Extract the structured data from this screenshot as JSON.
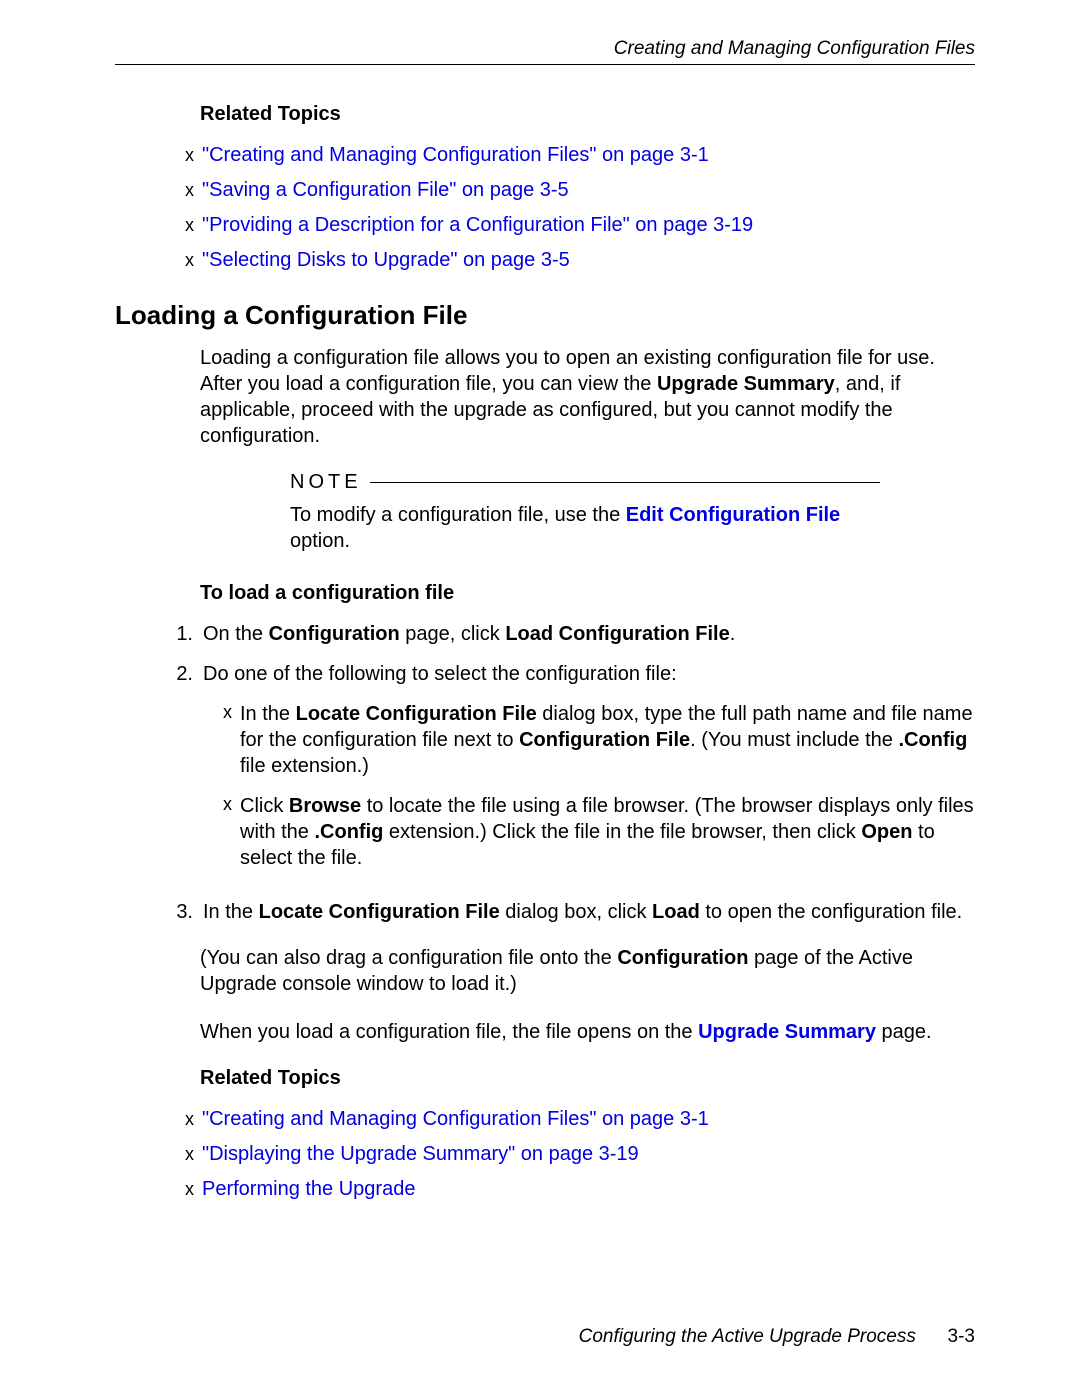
{
  "header": {
    "title": "Creating and Managing Configuration Files"
  },
  "relatedTopics1": {
    "heading": "Related Topics",
    "links": [
      "\"Creating and Managing Configuration Files\" on page 3-1",
      "\"Saving a Configuration File\" on page 3-5",
      "\"Providing a Description for a Configuration File\" on page 3-19",
      "\"Selecting Disks to Upgrade\" on page 3-5"
    ]
  },
  "section": {
    "heading": "Loading a Configuration File",
    "intro_part1": "Loading a configuration file allows you to open an existing configuration file for use. After you load a configuration file, you can view the ",
    "intro_bold1": "Upgrade Summary",
    "intro_part2": ", and, if applicable, proceed with the upgrade as configured, but you cannot modify the configuration."
  },
  "note": {
    "label": "NOTE",
    "text_part1": "To modify a configuration file, use the ",
    "link_text": "Edit Configuration File",
    "text_part2": " option."
  },
  "procedure": {
    "heading": "To load a configuration file",
    "step1_p1": "On the ",
    "step1_b1": "Configuration",
    "step1_p2": " page, click ",
    "step1_b2": "Load Configuration File",
    "step1_p3": ".",
    "step2_intro": "Do one of the following to select the configuration file:",
    "step2a_p1": "In the ",
    "step2a_b1": "Locate Configuration File",
    "step2a_p2": " dialog box, type the full path name and file name for the configuration file next to ",
    "step2a_b2": "Configuration File",
    "step2a_p3": ". (You must include the ",
    "step2a_b3": ".Config",
    "step2a_p4": " file extension.)",
    "step2b_p1": "Click ",
    "step2b_b1": "Browse",
    "step2b_p2": " to locate the file using a file browser. (The browser displays only files with the ",
    "step2b_b2": ".Config",
    "step2b_p3": " extension.) Click the file in the file browser, then click ",
    "step2b_b3": "Open",
    "step2b_p4": " to select the file.",
    "step3_p1": "In the ",
    "step3_b1": "Locate Configuration File",
    "step3_p2": " dialog box, click ",
    "step3_b2": "Load",
    "step3_p3": " to open the configuration file."
  },
  "after": {
    "para1_p1": "(You can also drag a configuration file onto the ",
    "para1_b1": "Configuration",
    "para1_p2": " page of the Active Upgrade console window to load it.)",
    "para2_p1": "When you load a configuration file, the file opens on the ",
    "para2_link": "Upgrade Summary",
    "para2_p2": " page."
  },
  "relatedTopics2": {
    "heading": "Related Topics",
    "links": [
      "\"Creating and Managing Configuration Files\" on page 3-1",
      "\"Displaying the Upgrade Summary\" on page 3-19",
      "Performing the Upgrade"
    ]
  },
  "footer": {
    "text": "Configuring the Active Upgrade Process",
    "page": "3-3"
  }
}
